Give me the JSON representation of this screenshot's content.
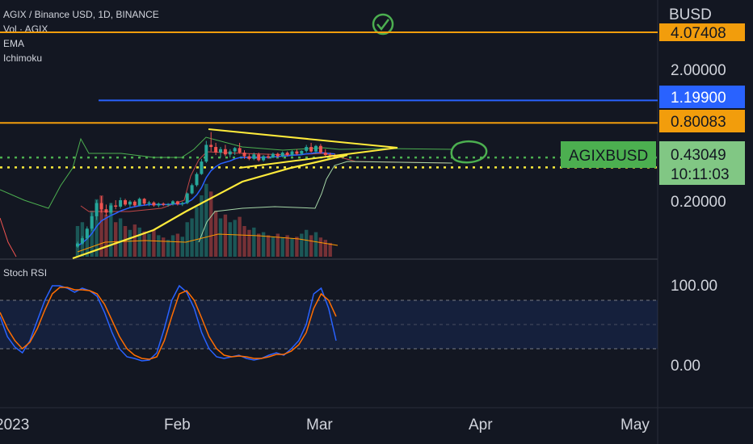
{
  "chart_data": {
    "type": "candlestick",
    "title": "AGIX / Binance USD, 1D, BINANCE",
    "currency": "BUSD",
    "indicators": [
      "Vol · AGIX",
      "EMA",
      "Ichimoku"
    ],
    "oscillator": {
      "name": "Stoch RSI",
      "ticks": [
        "100.00",
        "0.00"
      ],
      "band_upper": 80,
      "band_lower": 20,
      "ylim": [
        0,
        100
      ]
    },
    "price_labels": [
      {
        "text": "4.07408",
        "value": 4.07408,
        "color": "#f29d0c",
        "text_color": "#131722"
      },
      {
        "text": "1.19900",
        "value": 1.199,
        "color": "#2962ff",
        "text_color": "#ffffff"
      },
      {
        "text": "0.80083",
        "value": 0.80083,
        "color": "#f29d0c",
        "text_color": "#131722"
      },
      {
        "text": "0.43049",
        "value": 0.43049,
        "color": "#81c784",
        "text_color": "#131722"
      }
    ],
    "y_ticks": [
      "2.00000",
      "0.20000"
    ],
    "countdown": "10:11:03",
    "symbol_badge": "AGIXBUSD",
    "x_ticks": [
      "2023",
      "Feb",
      "Mar",
      "Apr",
      "May"
    ],
    "horizontal_lines": [
      {
        "value": 4.07408,
        "color": "#f29d0c",
        "style": "solid"
      },
      {
        "value": 1.199,
        "color": "#2962ff",
        "style": "solid"
      },
      {
        "value": 0.80083,
        "color": "#f29d0c",
        "style": "solid"
      },
      {
        "value": 0.43049,
        "color": "#4caf50",
        "style": "dotted"
      },
      {
        "value": 0.36,
        "color": "#ffeb3b",
        "style": "dotted"
      }
    ],
    "candles": [
      {
        "o": 0.087,
        "h": 0.095,
        "l": 0.085,
        "c": 0.092
      },
      {
        "o": 0.092,
        "h": 0.105,
        "l": 0.09,
        "c": 0.101
      },
      {
        "o": 0.101,
        "h": 0.125,
        "l": 0.098,
        "c": 0.12
      },
      {
        "o": 0.12,
        "h": 0.16,
        "l": 0.115,
        "c": 0.15
      },
      {
        "o": 0.15,
        "h": 0.2,
        "l": 0.14,
        "c": 0.19
      },
      {
        "o": 0.19,
        "h": 0.215,
        "l": 0.16,
        "c": 0.17
      },
      {
        "o": 0.17,
        "h": 0.185,
        "l": 0.15,
        "c": 0.16
      },
      {
        "o": 0.16,
        "h": 0.19,
        "l": 0.155,
        "c": 0.182
      },
      {
        "o": 0.182,
        "h": 0.2,
        "l": 0.17,
        "c": 0.178
      },
      {
        "o": 0.178,
        "h": 0.21,
        "l": 0.172,
        "c": 0.2
      },
      {
        "o": 0.2,
        "h": 0.205,
        "l": 0.18,
        "c": 0.185
      },
      {
        "o": 0.185,
        "h": 0.2,
        "l": 0.175,
        "c": 0.195
      },
      {
        "o": 0.195,
        "h": 0.2,
        "l": 0.178,
        "c": 0.182
      },
      {
        "o": 0.182,
        "h": 0.21,
        "l": 0.18,
        "c": 0.205
      },
      {
        "o": 0.205,
        "h": 0.208,
        "l": 0.182,
        "c": 0.188
      },
      {
        "o": 0.188,
        "h": 0.198,
        "l": 0.18,
        "c": 0.192
      },
      {
        "o": 0.192,
        "h": 0.196,
        "l": 0.178,
        "c": 0.182
      },
      {
        "o": 0.182,
        "h": 0.192,
        "l": 0.176,
        "c": 0.188
      },
      {
        "o": 0.188,
        "h": 0.192,
        "l": 0.18,
        "c": 0.184
      },
      {
        "o": 0.184,
        "h": 0.19,
        "l": 0.178,
        "c": 0.186
      },
      {
        "o": 0.186,
        "h": 0.2,
        "l": 0.182,
        "c": 0.196
      },
      {
        "o": 0.196,
        "h": 0.198,
        "l": 0.182,
        "c": 0.186
      },
      {
        "o": 0.186,
        "h": 0.195,
        "l": 0.18,
        "c": 0.19
      },
      {
        "o": 0.19,
        "h": 0.23,
        "l": 0.186,
        "c": 0.226
      },
      {
        "o": 0.226,
        "h": 0.27,
        "l": 0.222,
        "c": 0.262
      },
      {
        "o": 0.262,
        "h": 0.33,
        "l": 0.255,
        "c": 0.32
      },
      {
        "o": 0.32,
        "h": 0.42,
        "l": 0.315,
        "c": 0.4
      },
      {
        "o": 0.4,
        "h": 0.58,
        "l": 0.39,
        "c": 0.54
      },
      {
        "o": 0.54,
        "h": 0.68,
        "l": 0.48,
        "c": 0.52
      },
      {
        "o": 0.52,
        "h": 0.56,
        "l": 0.45,
        "c": 0.47
      },
      {
        "o": 0.47,
        "h": 0.52,
        "l": 0.43,
        "c": 0.5
      },
      {
        "o": 0.5,
        "h": 0.54,
        "l": 0.44,
        "c": 0.455
      },
      {
        "o": 0.455,
        "h": 0.5,
        "l": 0.43,
        "c": 0.48
      },
      {
        "o": 0.48,
        "h": 0.52,
        "l": 0.45,
        "c": 0.51
      },
      {
        "o": 0.51,
        "h": 0.56,
        "l": 0.46,
        "c": 0.47
      },
      {
        "o": 0.47,
        "h": 0.49,
        "l": 0.42,
        "c": 0.44
      },
      {
        "o": 0.44,
        "h": 0.46,
        "l": 0.41,
        "c": 0.42
      },
      {
        "o": 0.42,
        "h": 0.47,
        "l": 0.41,
        "c": 0.455
      },
      {
        "o": 0.455,
        "h": 0.47,
        "l": 0.4,
        "c": 0.41
      },
      {
        "o": 0.41,
        "h": 0.45,
        "l": 0.4,
        "c": 0.44
      },
      {
        "o": 0.44,
        "h": 0.46,
        "l": 0.42,
        "c": 0.43
      },
      {
        "o": 0.43,
        "h": 0.47,
        "l": 0.425,
        "c": 0.46
      },
      {
        "o": 0.46,
        "h": 0.47,
        "l": 0.43,
        "c": 0.44
      },
      {
        "o": 0.44,
        "h": 0.48,
        "l": 0.43,
        "c": 0.47
      },
      {
        "o": 0.47,
        "h": 0.48,
        "l": 0.44,
        "c": 0.45
      },
      {
        "o": 0.45,
        "h": 0.49,
        "l": 0.44,
        "c": 0.48
      },
      {
        "o": 0.48,
        "h": 0.5,
        "l": 0.45,
        "c": 0.46
      },
      {
        "o": 0.46,
        "h": 0.49,
        "l": 0.45,
        "c": 0.485
      },
      {
        "o": 0.485,
        "h": 0.54,
        "l": 0.47,
        "c": 0.52
      },
      {
        "o": 0.52,
        "h": 0.56,
        "l": 0.47,
        "c": 0.48
      },
      {
        "o": 0.48,
        "h": 0.54,
        "l": 0.46,
        "c": 0.53
      },
      {
        "o": 0.53,
        "h": 0.55,
        "l": 0.46,
        "c": 0.47
      },
      {
        "o": 0.47,
        "h": 0.5,
        "l": 0.44,
        "c": 0.45
      },
      {
        "o": 0.45,
        "h": 0.47,
        "l": 0.42,
        "c": 0.44
      },
      {
        "o": 0.44,
        "h": 0.46,
        "l": 0.42,
        "c": 0.43
      }
    ],
    "volumes": [
      0.4,
      0.45,
      0.35,
      0.6,
      0.75,
      0.8,
      0.55,
      0.7,
      0.45,
      0.5,
      0.4,
      0.35,
      0.42,
      0.38,
      0.33,
      0.3,
      0.35,
      0.28,
      0.25,
      0.22,
      0.28,
      0.3,
      0.26,
      0.45,
      0.5,
      0.65,
      0.8,
      0.95,
      0.85,
      0.6,
      0.5,
      0.55,
      0.45,
      0.48,
      0.52,
      0.4,
      0.35,
      0.38,
      0.3,
      0.32,
      0.28,
      0.26,
      0.3,
      0.25,
      0.28,
      0.24,
      0.26,
      0.3,
      0.35,
      0.28,
      0.32,
      0.25,
      0.22,
      0.18
    ],
    "ema": [
      0.088,
      0.093,
      0.1,
      0.11,
      0.125,
      0.138,
      0.145,
      0.152,
      0.158,
      0.165,
      0.17,
      0.175,
      0.178,
      0.181,
      0.183,
      0.185,
      0.185,
      0.185,
      0.185,
      0.185,
      0.187,
      0.187,
      0.187,
      0.192,
      0.202,
      0.22,
      0.25,
      0.3,
      0.34,
      0.365,
      0.385,
      0.395,
      0.405,
      0.42,
      0.43,
      0.432,
      0.43,
      0.435,
      0.43,
      0.432,
      0.432,
      0.436,
      0.437,
      0.442,
      0.443,
      0.448,
      0.45,
      0.453,
      0.46,
      0.463,
      0.47,
      0.47,
      0.466,
      0.462,
      0.458
    ],
    "stoch_k": [
      60,
      35,
      22,
      15,
      30,
      55,
      80,
      98,
      98,
      95,
      90,
      95,
      92,
      85,
      65,
      40,
      20,
      10,
      8,
      5,
      6,
      15,
      45,
      80,
      98,
      90,
      70,
      40,
      20,
      10,
      8,
      10,
      12,
      8,
      6,
      8,
      12,
      15,
      12,
      20,
      30,
      50,
      88,
      95,
      70,
      30
    ],
    "stoch_d": [
      65,
      45,
      30,
      20,
      28,
      45,
      68,
      88,
      96,
      96,
      93,
      93,
      92,
      88,
      75,
      55,
      35,
      20,
      12,
      8,
      7,
      10,
      30,
      60,
      88,
      92,
      80,
      58,
      35,
      20,
      12,
      10,
      11,
      10,
      8,
      8,
      10,
      13,
      13,
      17,
      25,
      40,
      70,
      88,
      80,
      60
    ]
  }
}
